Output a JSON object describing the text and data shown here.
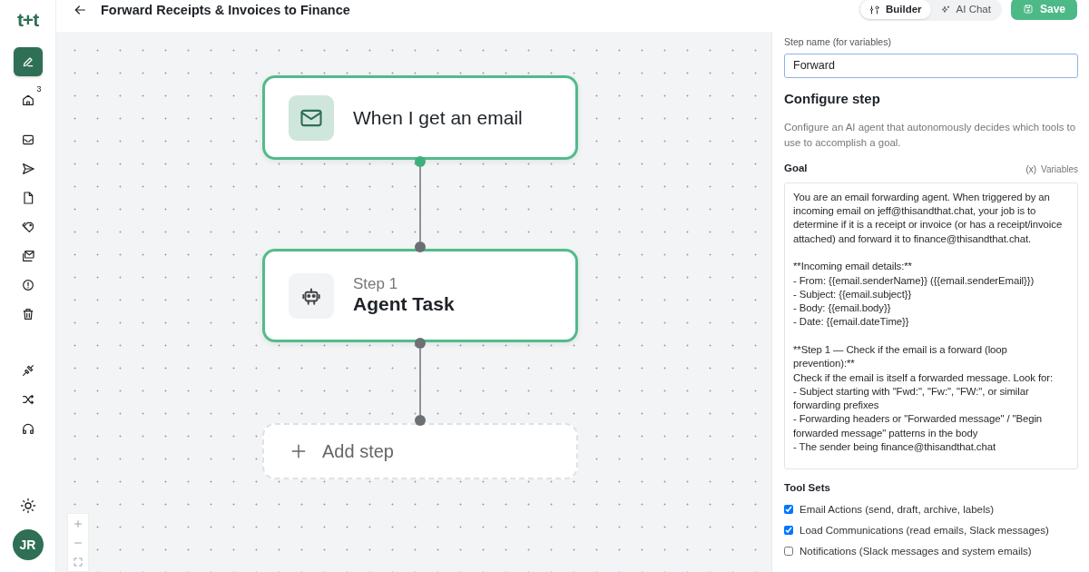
{
  "sidebar": {
    "logo": "t+t",
    "groups": [
      [
        {
          "selected": true
        },
        {
          "selected": false,
          "badge": "3"
        }
      ],
      [
        {
          "selected": false
        },
        {
          "selected": false
        },
        {
          "selected": false
        },
        {
          "selected": false
        },
        {
          "selected": false
        },
        {
          "selected": false
        },
        {
          "selected": false
        }
      ],
      [
        {
          "selected": false
        },
        {
          "selected": false
        },
        {
          "selected": false
        }
      ]
    ],
    "avatar": "JR"
  },
  "header": {
    "title": "Forward Receipts & Invoices to Finance",
    "view_tabs": [
      {
        "label": "Builder",
        "selected": true
      },
      {
        "label": "AI Chat",
        "selected": false
      }
    ],
    "save_button": "Save"
  },
  "canvas": {
    "nodes": [
      {
        "kind": "trigger",
        "title": "When I get an email"
      },
      {
        "kind": "step",
        "subtitle": "Step 1",
        "title": "Agent Task"
      },
      {
        "kind": "add",
        "title": "Add step"
      }
    ]
  },
  "panel": {
    "step_name": {
      "label": "Step name (for variables)",
      "value": "Forward"
    },
    "heading": "Configure step",
    "description": "Configure an AI agent that autonomously decides which tools to use to accomplish a goal.",
    "goal": {
      "label": "Goal",
      "variables_icon": "(x)",
      "variables_label": "Variables",
      "text": "You are an email forwarding agent. When triggered by an\nincoming email on jeff@thisandthat.chat, your job is to\ndetermine if it is a receipt or invoice (or has a receipt/invoice\nattached) and forward it to finance@thisandthat.chat.\n\n**Incoming email details:**\n- From: {{email.senderName}} ({{email.senderEmail}})\n- Subject: {{email.subject}}\n- Body: {{email.body}}\n- Date: {{email.dateTime}}\n\n**Step 1 — Check if the email is a forward (loop\nprevention):**\nCheck if the email is itself a forwarded message. Look for:\n- Subject starting with \"Fwd:\", \"Fw:\", \"FW:\", or similar\nforwarding prefixes\n- Forwarding headers or \"Forwarded message\" / \"Begin\nforwarded message\" patterns in the body\n- The sender being finance@thisandthat.chat"
    },
    "tool_sets": {
      "heading": "Tool Sets",
      "items": [
        {
          "label": "Email Actions (send, draft, archive, labels)",
          "checked": true
        },
        {
          "label": "Load Communications (read emails, Slack messages)",
          "checked": true
        },
        {
          "label": "Notifications (Slack messages and system emails)",
          "checked": false
        }
      ]
    }
  }
}
